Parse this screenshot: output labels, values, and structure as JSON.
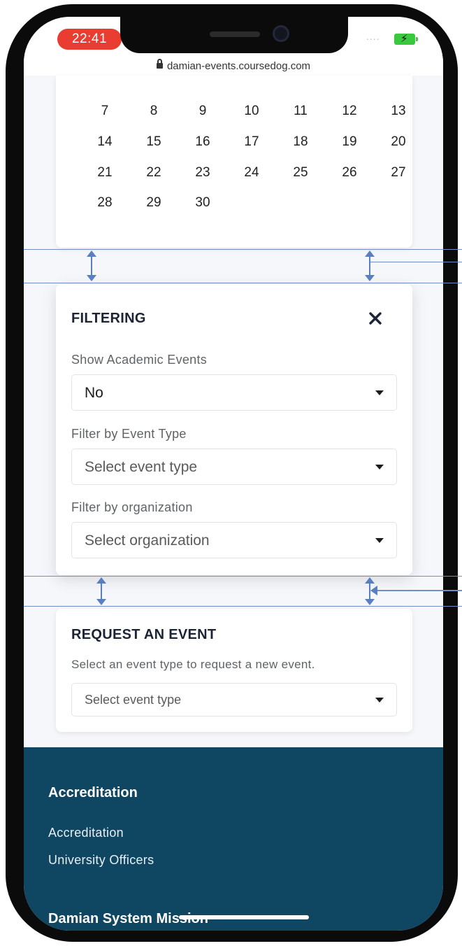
{
  "status_bar": {
    "time": "22:41",
    "signal": "....",
    "battery_icon": "battery-charging-icon",
    "battery_color": "#3ac93e",
    "time_pill_color": "#ea3d32"
  },
  "browser": {
    "url": "damian-events.coursedog.com",
    "lock_icon": "lock-icon"
  },
  "calendar": {
    "rows": [
      [
        "7",
        "8",
        "9",
        "10",
        "11",
        "12",
        "13"
      ],
      [
        "14",
        "15",
        "16",
        "17",
        "18",
        "19",
        "20"
      ],
      [
        "21",
        "22",
        "23",
        "24",
        "25",
        "26",
        "27"
      ],
      [
        "28",
        "29",
        "30"
      ]
    ]
  },
  "filtering": {
    "title": "FILTERING",
    "close_icon": "close-icon",
    "academic_label": "Show Academic Events",
    "academic_value": "No",
    "event_type_label": "Filter by Event Type",
    "event_type_placeholder": "Select event type",
    "organization_label": "Filter by organization",
    "organization_placeholder": "Select organization"
  },
  "request": {
    "title": "REQUEST AN EVENT",
    "description": "Select an event type to request a new event.",
    "select_placeholder": "Select event type"
  },
  "footer": {
    "background_color": "#0f4763",
    "heading": "Accreditation",
    "links": [
      "Accreditation",
      "University Officers"
    ],
    "second_heading": "Damian System Mission"
  },
  "annotations": {
    "line_color": "#6f8fc9"
  }
}
